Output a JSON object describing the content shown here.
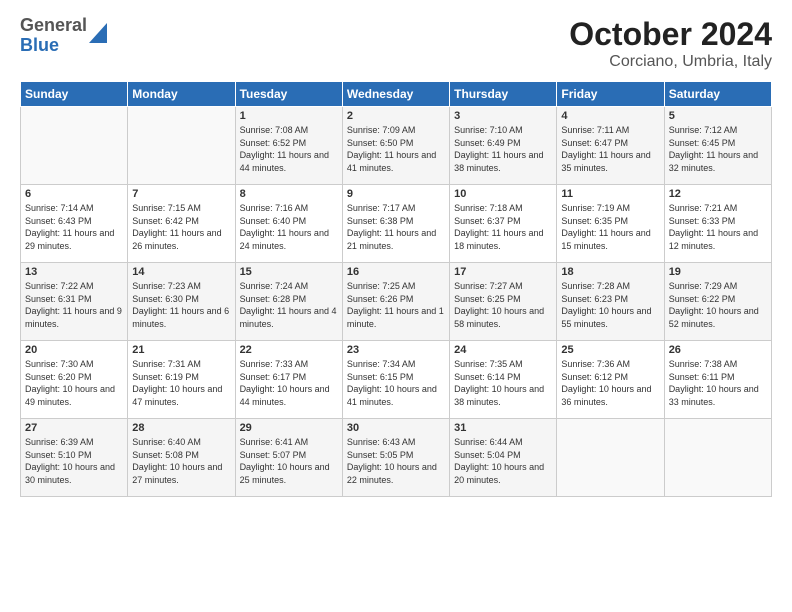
{
  "header": {
    "logo_general": "General",
    "logo_blue": "Blue",
    "title": "October 2024",
    "subtitle": "Corciano, Umbria, Italy"
  },
  "calendar": {
    "days_of_week": [
      "Sunday",
      "Monday",
      "Tuesday",
      "Wednesday",
      "Thursday",
      "Friday",
      "Saturday"
    ],
    "weeks": [
      [
        {
          "day": "",
          "content": ""
        },
        {
          "day": "",
          "content": ""
        },
        {
          "day": "1",
          "content": "Sunrise: 7:08 AM\nSunset: 6:52 PM\nDaylight: 11 hours and 44 minutes."
        },
        {
          "day": "2",
          "content": "Sunrise: 7:09 AM\nSunset: 6:50 PM\nDaylight: 11 hours and 41 minutes."
        },
        {
          "day": "3",
          "content": "Sunrise: 7:10 AM\nSunset: 6:49 PM\nDaylight: 11 hours and 38 minutes."
        },
        {
          "day": "4",
          "content": "Sunrise: 7:11 AM\nSunset: 6:47 PM\nDaylight: 11 hours and 35 minutes."
        },
        {
          "day": "5",
          "content": "Sunrise: 7:12 AM\nSunset: 6:45 PM\nDaylight: 11 hours and 32 minutes."
        }
      ],
      [
        {
          "day": "6",
          "content": "Sunrise: 7:14 AM\nSunset: 6:43 PM\nDaylight: 11 hours and 29 minutes."
        },
        {
          "day": "7",
          "content": "Sunrise: 7:15 AM\nSunset: 6:42 PM\nDaylight: 11 hours and 26 minutes."
        },
        {
          "day": "8",
          "content": "Sunrise: 7:16 AM\nSunset: 6:40 PM\nDaylight: 11 hours and 24 minutes."
        },
        {
          "day": "9",
          "content": "Sunrise: 7:17 AM\nSunset: 6:38 PM\nDaylight: 11 hours and 21 minutes."
        },
        {
          "day": "10",
          "content": "Sunrise: 7:18 AM\nSunset: 6:37 PM\nDaylight: 11 hours and 18 minutes."
        },
        {
          "day": "11",
          "content": "Sunrise: 7:19 AM\nSunset: 6:35 PM\nDaylight: 11 hours and 15 minutes."
        },
        {
          "day": "12",
          "content": "Sunrise: 7:21 AM\nSunset: 6:33 PM\nDaylight: 11 hours and 12 minutes."
        }
      ],
      [
        {
          "day": "13",
          "content": "Sunrise: 7:22 AM\nSunset: 6:31 PM\nDaylight: 11 hours and 9 minutes."
        },
        {
          "day": "14",
          "content": "Sunrise: 7:23 AM\nSunset: 6:30 PM\nDaylight: 11 hours and 6 minutes."
        },
        {
          "day": "15",
          "content": "Sunrise: 7:24 AM\nSunset: 6:28 PM\nDaylight: 11 hours and 4 minutes."
        },
        {
          "day": "16",
          "content": "Sunrise: 7:25 AM\nSunset: 6:26 PM\nDaylight: 11 hours and 1 minute."
        },
        {
          "day": "17",
          "content": "Sunrise: 7:27 AM\nSunset: 6:25 PM\nDaylight: 10 hours and 58 minutes."
        },
        {
          "day": "18",
          "content": "Sunrise: 7:28 AM\nSunset: 6:23 PM\nDaylight: 10 hours and 55 minutes."
        },
        {
          "day": "19",
          "content": "Sunrise: 7:29 AM\nSunset: 6:22 PM\nDaylight: 10 hours and 52 minutes."
        }
      ],
      [
        {
          "day": "20",
          "content": "Sunrise: 7:30 AM\nSunset: 6:20 PM\nDaylight: 10 hours and 49 minutes."
        },
        {
          "day": "21",
          "content": "Sunrise: 7:31 AM\nSunset: 6:19 PM\nDaylight: 10 hours and 47 minutes."
        },
        {
          "day": "22",
          "content": "Sunrise: 7:33 AM\nSunset: 6:17 PM\nDaylight: 10 hours and 44 minutes."
        },
        {
          "day": "23",
          "content": "Sunrise: 7:34 AM\nSunset: 6:15 PM\nDaylight: 10 hours and 41 minutes."
        },
        {
          "day": "24",
          "content": "Sunrise: 7:35 AM\nSunset: 6:14 PM\nDaylight: 10 hours and 38 minutes."
        },
        {
          "day": "25",
          "content": "Sunrise: 7:36 AM\nSunset: 6:12 PM\nDaylight: 10 hours and 36 minutes."
        },
        {
          "day": "26",
          "content": "Sunrise: 7:38 AM\nSunset: 6:11 PM\nDaylight: 10 hours and 33 minutes."
        }
      ],
      [
        {
          "day": "27",
          "content": "Sunrise: 6:39 AM\nSunset: 5:10 PM\nDaylight: 10 hours and 30 minutes."
        },
        {
          "day": "28",
          "content": "Sunrise: 6:40 AM\nSunset: 5:08 PM\nDaylight: 10 hours and 27 minutes."
        },
        {
          "day": "29",
          "content": "Sunrise: 6:41 AM\nSunset: 5:07 PM\nDaylight: 10 hours and 25 minutes."
        },
        {
          "day": "30",
          "content": "Sunrise: 6:43 AM\nSunset: 5:05 PM\nDaylight: 10 hours and 22 minutes."
        },
        {
          "day": "31",
          "content": "Sunrise: 6:44 AM\nSunset: 5:04 PM\nDaylight: 10 hours and 20 minutes."
        },
        {
          "day": "",
          "content": ""
        },
        {
          "day": "",
          "content": ""
        }
      ]
    ]
  }
}
